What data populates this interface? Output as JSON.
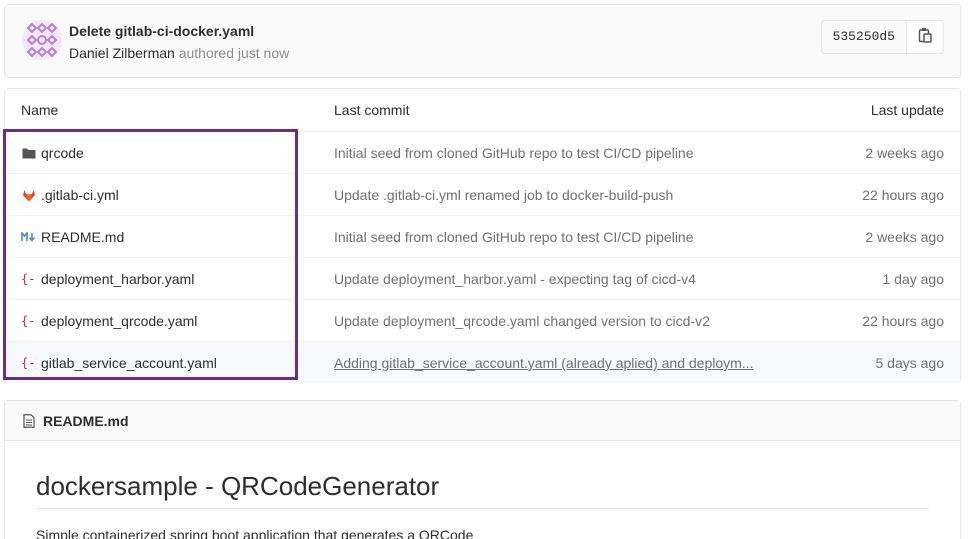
{
  "commit": {
    "title": "Delete gitlab-ci-docker.yaml",
    "author": "Daniel Zilberman",
    "meta_suffix": "authored just now",
    "sha": "535250d5"
  },
  "table": {
    "headers": {
      "name": "Name",
      "last_commit": "Last commit",
      "last_update": "Last update"
    },
    "rows": [
      {
        "name": "qrcode",
        "icon": "folder-icon",
        "commit": "Initial seed from cloned GitHub repo to test CI/CD pipeline",
        "date": "2 weeks ago"
      },
      {
        "name": ".gitlab-ci.yml",
        "icon": "gitlab-icon",
        "commit": "Update .gitlab-ci.yml renamed job to docker-build-push",
        "date": "22 hours ago"
      },
      {
        "name": "README.md",
        "icon": "markdown-icon",
        "commit": "Initial seed from cloned GitHub repo to test CI/CD pipeline",
        "date": "2 weeks ago"
      },
      {
        "name": "deployment_harbor.yaml",
        "icon": "yaml-icon",
        "commit": "Update deployment_harbor.yaml - expecting tag of cicd-v4",
        "date": "1 day ago"
      },
      {
        "name": "deployment_qrcode.yaml",
        "icon": "yaml-icon",
        "commit": "Update deployment_qrcode.yaml changed version to cicd-v2",
        "date": "22 hours ago"
      },
      {
        "name": "gitlab_service_account.yaml",
        "icon": "yaml-icon",
        "commit": "Adding gitlab_service_account.yaml (already aplied) and deploym...",
        "date": "5 days ago"
      }
    ]
  },
  "readme": {
    "filename": "README.md",
    "heading": "dockersample - QRCodeGenerator",
    "body": "Simple containerized spring boot application that generates a QRCode"
  },
  "colors": {
    "highlight_frame": "#6b2d8a",
    "gitlab_orange": "#e24329",
    "yaml_red": "#d22128",
    "markdown_blue": "#4a8bc8"
  }
}
